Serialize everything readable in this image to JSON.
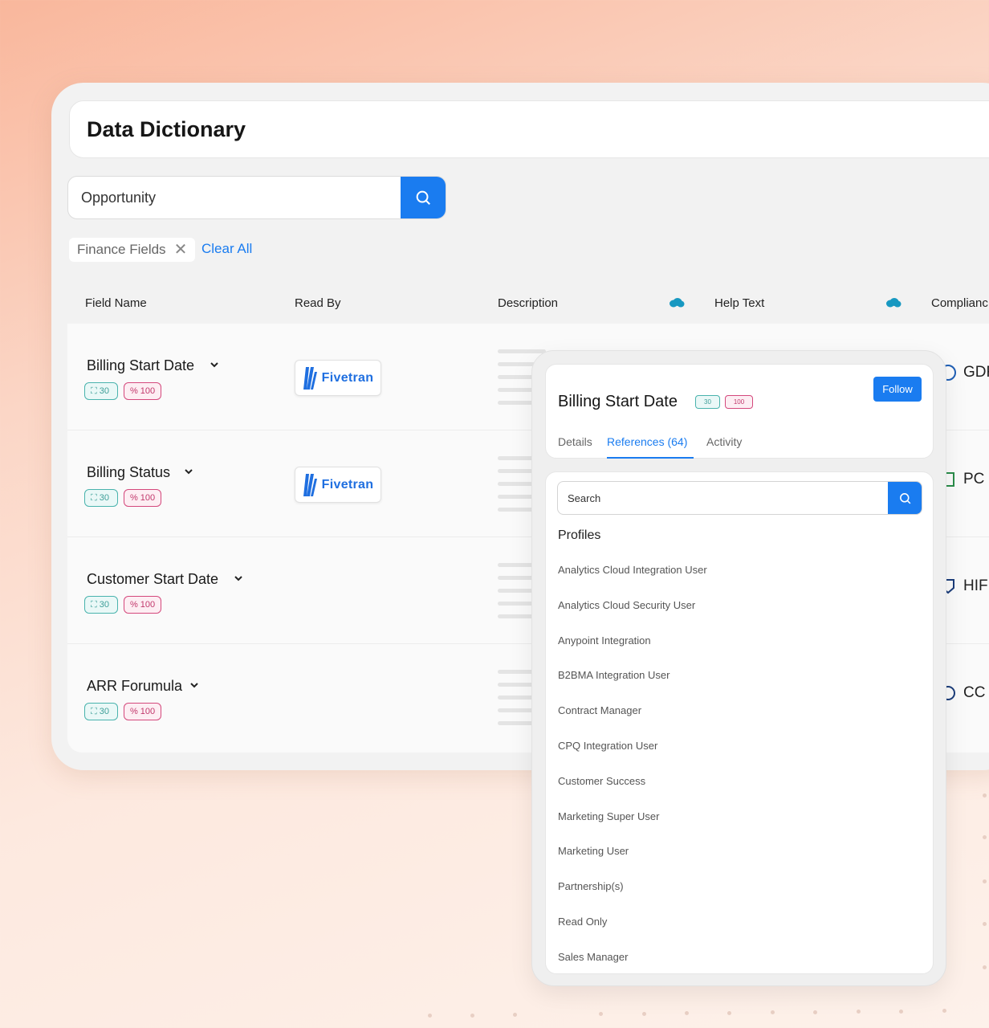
{
  "app_title": "Data Dictionary",
  "search": {
    "value": "Opportunity"
  },
  "filters": {
    "chip_label": "Finance Fields",
    "clear_all": "Clear All"
  },
  "columns": {
    "field_name": "Field Name",
    "read_by": "Read By",
    "description": "Description",
    "help_text": "Help Text",
    "compliance": "Complianc"
  },
  "badge_values": {
    "teal": "30",
    "pink": "100"
  },
  "rows": [
    {
      "name": "Billing Start Date",
      "read_by": "Fivetran",
      "compliance": "GDF"
    },
    {
      "name": "Billing Status",
      "read_by": "Fivetran",
      "compliance": "PC"
    },
    {
      "name": "Customer Start Date",
      "read_by": "",
      "compliance": "HIF"
    },
    {
      "name": "ARR Forumula",
      "read_by": "",
      "compliance": "CC"
    }
  ],
  "panel": {
    "title": "Billing Start Date",
    "follow": "Follow",
    "tabs": [
      "Details",
      "References (64)",
      "Activity"
    ],
    "active_tab": "References (64)",
    "search_value": "Search",
    "section_title": "Profiles",
    "profiles": [
      "Analytics Cloud Integration User",
      "Analytics Cloud Security User",
      "Anypoint Integration",
      "B2BMA Integration User",
      "Contract Manager",
      "CPQ Integration User",
      "Customer Success",
      "Marketing Super User",
      "Marketing User",
      "Partnership(s)",
      "Read Only",
      "Sales Manager"
    ]
  },
  "colors": {
    "accent": "#1a7cf0",
    "teal": "#49b3ad",
    "pink": "#d4487c"
  }
}
